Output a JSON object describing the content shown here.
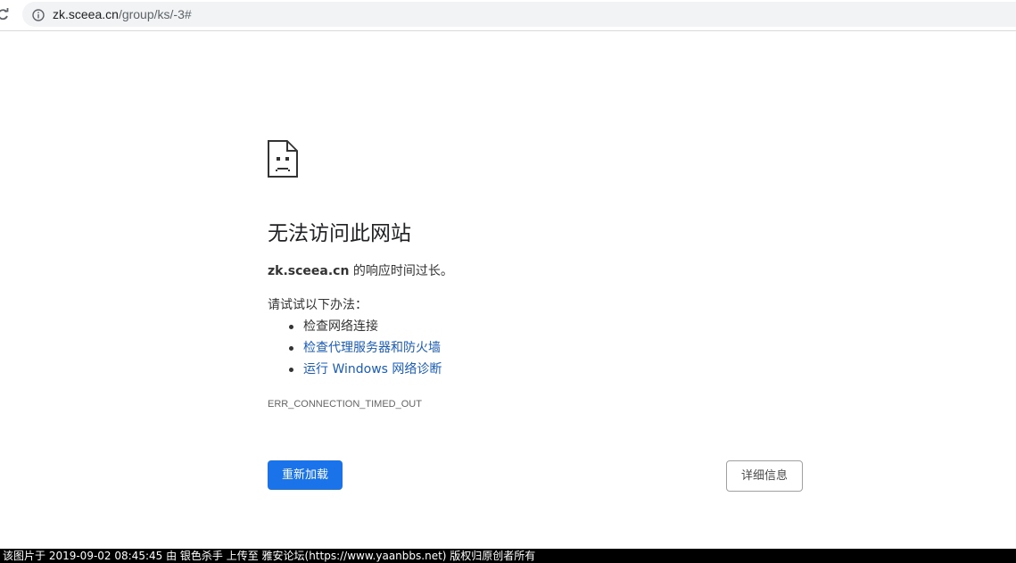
{
  "browser": {
    "url_host": "zk.sceea.cn",
    "url_path": "/group/ks/-3#",
    "icons": {
      "reload": "reload-icon",
      "site_info": "info-icon"
    }
  },
  "error_page": {
    "icon": "sad-page-icon",
    "title": "无法访问此网站",
    "description_host": "zk.sceea.cn",
    "description_text": " 的响应时间过长。",
    "suggestions_heading": "请试试以下办法：",
    "suggestions": [
      {
        "label": "检查网络连接",
        "is_link": false
      },
      {
        "label": "检查代理服务器和防火墙",
        "is_link": true
      },
      {
        "label": "运行 Windows 网络诊断",
        "is_link": true
      }
    ],
    "error_code": "ERR_CONNECTION_TIMED_OUT",
    "reload_label": "重新加载",
    "details_label": "详细信息"
  },
  "colors": {
    "primary_button": "#1a73e8",
    "link": "#1a5cb8",
    "omnibox_bg": "#f1f3f4"
  },
  "watermark": {
    "text": "该图片于 2019-09-02 08:45:45 由 银色杀手 上传至 雅安论坛(https://www.yaanbbs.net) 版权归原创者所有"
  }
}
